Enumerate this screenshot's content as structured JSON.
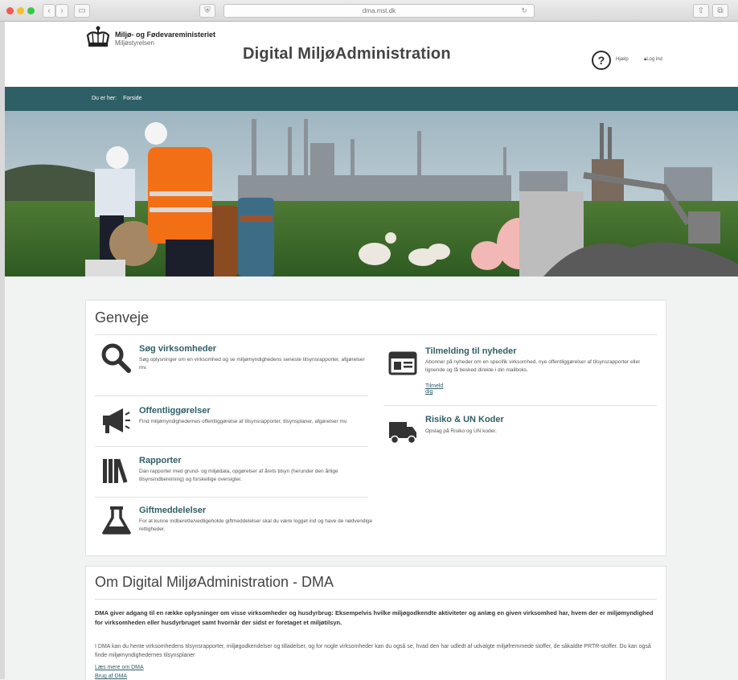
{
  "browser": {
    "url": "dma.mst.dk",
    "back_label": "‹",
    "forward_label": "›",
    "sidebar_label": "▭",
    "shield_label": "⛨",
    "reload_label": "↻",
    "share_label": "⇧",
    "tabs_label": "⧉"
  },
  "header": {
    "ministry": "Miljø- og Fødevareministeriet",
    "agency": "Miljøstyrelsen",
    "title": "Digital MiljøAdministration",
    "help_icon": "?",
    "help_label": "Hjælp",
    "login_label": "Log ind"
  },
  "breadcrumb": {
    "prefix": "Du er her:",
    "current": "Forside"
  },
  "shortcuts": {
    "title": "Genveje",
    "items": [
      {
        "title": "Søg virksomheder",
        "desc": "Søg oplysninger om en virksomhed og se miljømyndighedens seneste tilsynsrapporter, afgørelser mv.",
        "icon": "search-icon"
      },
      {
        "title": "Offentliggørelser",
        "desc": "Find miljømyndighedernes offentliggørelse af tilsynsrapporter, tilsynsplaner, afgørelser mv.",
        "icon": "megaphone-icon"
      },
      {
        "title": "Rapporter",
        "desc": "Dan rapporter med grund- og miljødata, opgørelser af årets tilsyn (herunder den årlige tilsynsindberetning) og forskellige oversigter.",
        "icon": "books-icon"
      },
      {
        "title": "Giftmeddelelser",
        "desc": "For at kunne indberette/vedligeholde giftmeddelelser skal du være logget ind og have de nødvendige rettigheder.",
        "icon": "flask-icon"
      },
      {
        "title": "Tilmelding til nyheder",
        "desc": "Abonner på nyheder om en specifik virksomhed, nye offentliggørelser af tilsynsrapporter eller lignende og få besked direkte i din mailboks.",
        "link": "Tilmeld dig",
        "icon": "newsletter-icon"
      },
      {
        "title": "Risiko & UN Koder",
        "desc": "Opslag på Risiko og UN koder.",
        "icon": "truck-icon"
      }
    ]
  },
  "about": {
    "title": "Om Digital MiljøAdministration - DMA",
    "intro": "DMA giver adgang til en række oplysninger om visse virksomheder og husdyrbrug: Eksempelvis hvilke miljøgodkendte aktiviteter og anlæg en given virksomhed har, hvem der er miljømyndighed for virksomheden eller husdyrbruget samt hvornår der sidst er foretaget et miljøtilsyn.",
    "body": "I DMA kan du hente virksomhedens tilsynsrapporter, miljøgodkendelser og tilladelser, og for nogle virksomheder kan du også se, hvad den har udledt af udvalgte miljøfremmede stoffer, de såkaldte PRTR-stoffer. Du kan også finde miljømyndighedernes tilsynsplaner",
    "link1": "Læs mere om DMA",
    "link2": "Brug af DMA"
  },
  "colors": {
    "accent": "#2f5f66",
    "background": "#f1f2f2"
  }
}
